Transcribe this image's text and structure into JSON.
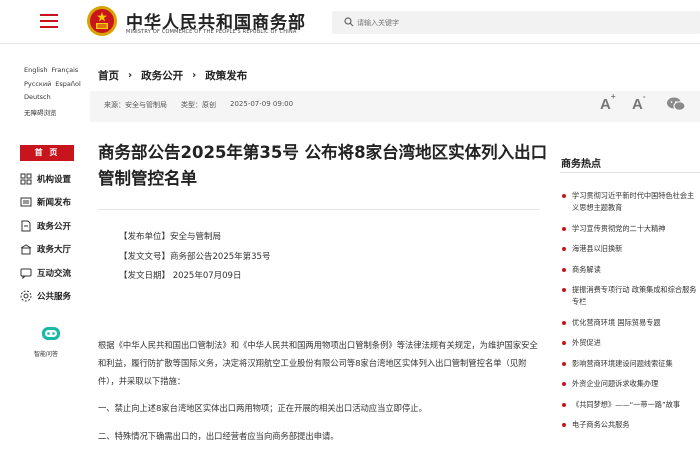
{
  "header": {
    "site_title": "中华人民共和国商务部",
    "site_subtitle": "MINISTRY OF COMMERCE OF THE PEOPLE'S REPUBLIC OF CHINA",
    "search_placeholder": "请输入关键字",
    "brand_red": "#c8151d"
  },
  "languages": [
    [
      "English",
      "Français"
    ],
    [
      "Русский",
      "Español"
    ],
    [
      "Deutsch"
    ],
    [
      "无障碍浏览"
    ]
  ],
  "sidebar": {
    "home": "首 页",
    "items": [
      {
        "label": "机构设置",
        "icon": "org-icon"
      },
      {
        "label": "新闻发布",
        "icon": "news-icon"
      },
      {
        "label": "政务公开",
        "icon": "doc-icon"
      },
      {
        "label": "政务大厅",
        "icon": "hall-icon"
      },
      {
        "label": "互动交流",
        "icon": "chat-icon"
      },
      {
        "label": "公共服务",
        "icon": "service-icon"
      }
    ],
    "assistant_label": "智能问答"
  },
  "breadcrumb": [
    "首页",
    "政务公开",
    "政策发布"
  ],
  "meta": {
    "source": "来源：安全与管制局",
    "type": "类型：原创",
    "date": "2025-07-09 09:00",
    "font_large": "A",
    "font_small": "A"
  },
  "article": {
    "title": "商务部公告2025年第35号 公布将8家台湾地区实体列入出口管制管控名单",
    "issuer": "【发布单位】安全与管制局",
    "doc_no": "【发文文号】商务部公告2025年第35号",
    "issue_date": "【发文日期】 2025年07月09日",
    "para1": "根据《中华人民共和国出口管制法》和《中华人民共和国两用物项出口管制条例》等法律法规有关规定，为维护国家安全和利益，履行防扩散等国际义务，决定将汉翔航空工业股份有限公司等8家台湾地区实体列入出口管制管控名单（见附件），并采取以下措施：",
    "para2": "一、禁止向上述8家台湾地区实体出口两用物项；正在开展的相关出口活动应当立即停止。",
    "para3": "二、特殊情况下确需出口的，出口经营者应当向商务部提出申请。"
  },
  "hot": {
    "title": "商务热点",
    "items": [
      "学习贯彻习近平新时代中国特色社会主义思想主题教育",
      "学习宣传贯彻党的二十大精神",
      "海港县以旧换新",
      "商务解读",
      "提振消费专项行动 政策集成和综合服务专栏",
      "优化营商环境 国际贸易专题",
      "外贸促进",
      "影响营商环境建设问题线索征集",
      "外资企业问题诉求收集办理",
      "《共同梦想》——“一带一路”故事",
      "电子商务公共服务"
    ]
  }
}
